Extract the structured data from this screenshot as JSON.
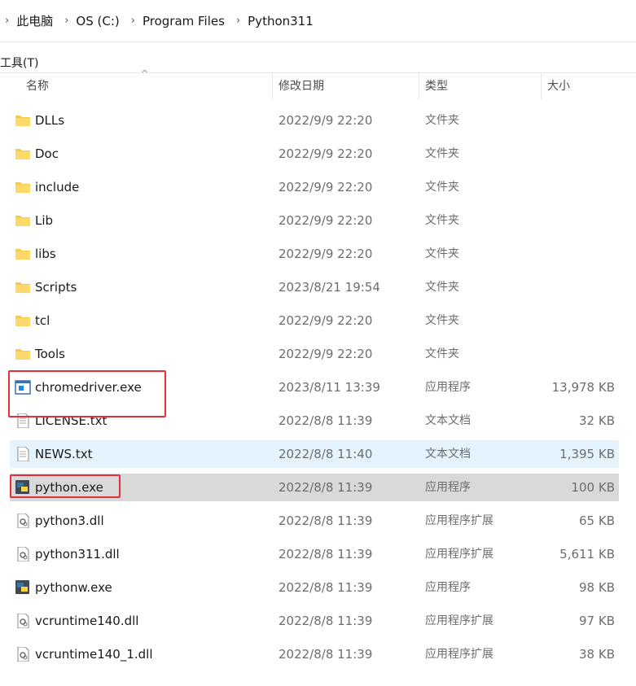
{
  "breadcrumb": [
    "此电脑",
    "OS (C:)",
    "Program Files",
    "Python311"
  ],
  "menu": {
    "tools": "工具(T)"
  },
  "columns": {
    "name": "名称",
    "modified": "修改日期",
    "type": "类型",
    "size": "大小"
  },
  "files": [
    {
      "name": "DLLs",
      "date": "2022/9/9 22:20",
      "type": "文件夹",
      "size": "",
      "icon": "folder-icon"
    },
    {
      "name": "Doc",
      "date": "2022/9/9 22:20",
      "type": "文件夹",
      "size": "",
      "icon": "folder-icon"
    },
    {
      "name": "include",
      "date": "2022/9/9 22:20",
      "type": "文件夹",
      "size": "",
      "icon": "folder-icon"
    },
    {
      "name": "Lib",
      "date": "2022/9/9 22:20",
      "type": "文件夹",
      "size": "",
      "icon": "folder-icon"
    },
    {
      "name": "libs",
      "date": "2022/9/9 22:20",
      "type": "文件夹",
      "size": "",
      "icon": "folder-icon"
    },
    {
      "name": "Scripts",
      "date": "2023/8/21 19:54",
      "type": "文件夹",
      "size": "",
      "icon": "folder-icon"
    },
    {
      "name": "tcl",
      "date": "2022/9/9 22:20",
      "type": "文件夹",
      "size": "",
      "icon": "folder-icon"
    },
    {
      "name": "Tools",
      "date": "2022/9/9 22:20",
      "type": "文件夹",
      "size": "",
      "icon": "folder-icon"
    },
    {
      "name": "chromedriver.exe",
      "date": "2023/8/11 13:39",
      "type": "应用程序",
      "size": "13,978 KB",
      "icon": "application-icon"
    },
    {
      "name": "LICENSE.txt",
      "date": "2022/8/8 11:39",
      "type": "文本文档",
      "size": "32 KB",
      "icon": "text-document-icon"
    },
    {
      "name": "NEWS.txt",
      "date": "2022/8/8 11:40",
      "type": "文本文档",
      "size": "1,395 KB",
      "icon": "text-document-icon"
    },
    {
      "name": "python.exe",
      "date": "2022/8/8 11:39",
      "type": "应用程序",
      "size": "100 KB",
      "icon": "python-icon"
    },
    {
      "name": "python3.dll",
      "date": "2022/8/8 11:39",
      "type": "应用程序扩展",
      "size": "65 KB",
      "icon": "dll-icon"
    },
    {
      "name": "python311.dll",
      "date": "2022/8/8 11:39",
      "type": "应用程序扩展",
      "size": "5,611 KB",
      "icon": "dll-icon"
    },
    {
      "name": "pythonw.exe",
      "date": "2022/8/8 11:39",
      "type": "应用程序",
      "size": "98 KB",
      "icon": "python-icon"
    },
    {
      "name": "vcruntime140.dll",
      "date": "2022/8/8 11:39",
      "type": "应用程序扩展",
      "size": "97 KB",
      "icon": "dll-icon"
    },
    {
      "name": "vcruntime140_1.dll",
      "date": "2022/8/8 11:39",
      "type": "应用程序扩展",
      "size": "38 KB",
      "icon": "dll-icon"
    }
  ],
  "colors": {
    "highlight_box": "#e0303a",
    "hover_row": "#e5f3ff",
    "selected_row": "#d9d9d9",
    "folder": "#f8c948"
  }
}
